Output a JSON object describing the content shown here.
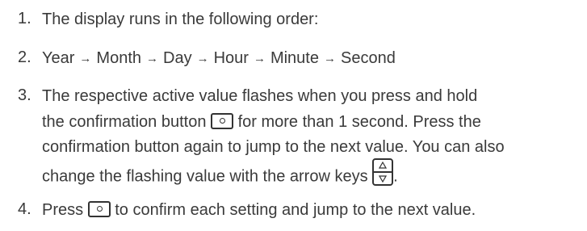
{
  "items": [
    {
      "number": "1.",
      "text": "The display runs in the following order:"
    },
    {
      "number": "2.",
      "sequence": [
        "Year",
        "Month",
        "Day",
        "Hour",
        "Minute",
        "Second"
      ],
      "arrow_glyph": "→"
    },
    {
      "number": "3.",
      "line1": "The respective active value flashes when you press and hold",
      "line2_before": "the confirmation button",
      "line2_after": "for more than 1 second. Press the",
      "line3": "confirmation button again to jump to the next value. You can also",
      "line4_before": "change the flashing value with the arrow keys",
      "line4_after": "."
    },
    {
      "number": "4.",
      "before": "Press",
      "after": "to confirm each setting and jump to the next value."
    }
  ],
  "icons": {
    "confirm_button": "confirm-button-icon",
    "arrow_keys": "arrow-keys-icon"
  }
}
